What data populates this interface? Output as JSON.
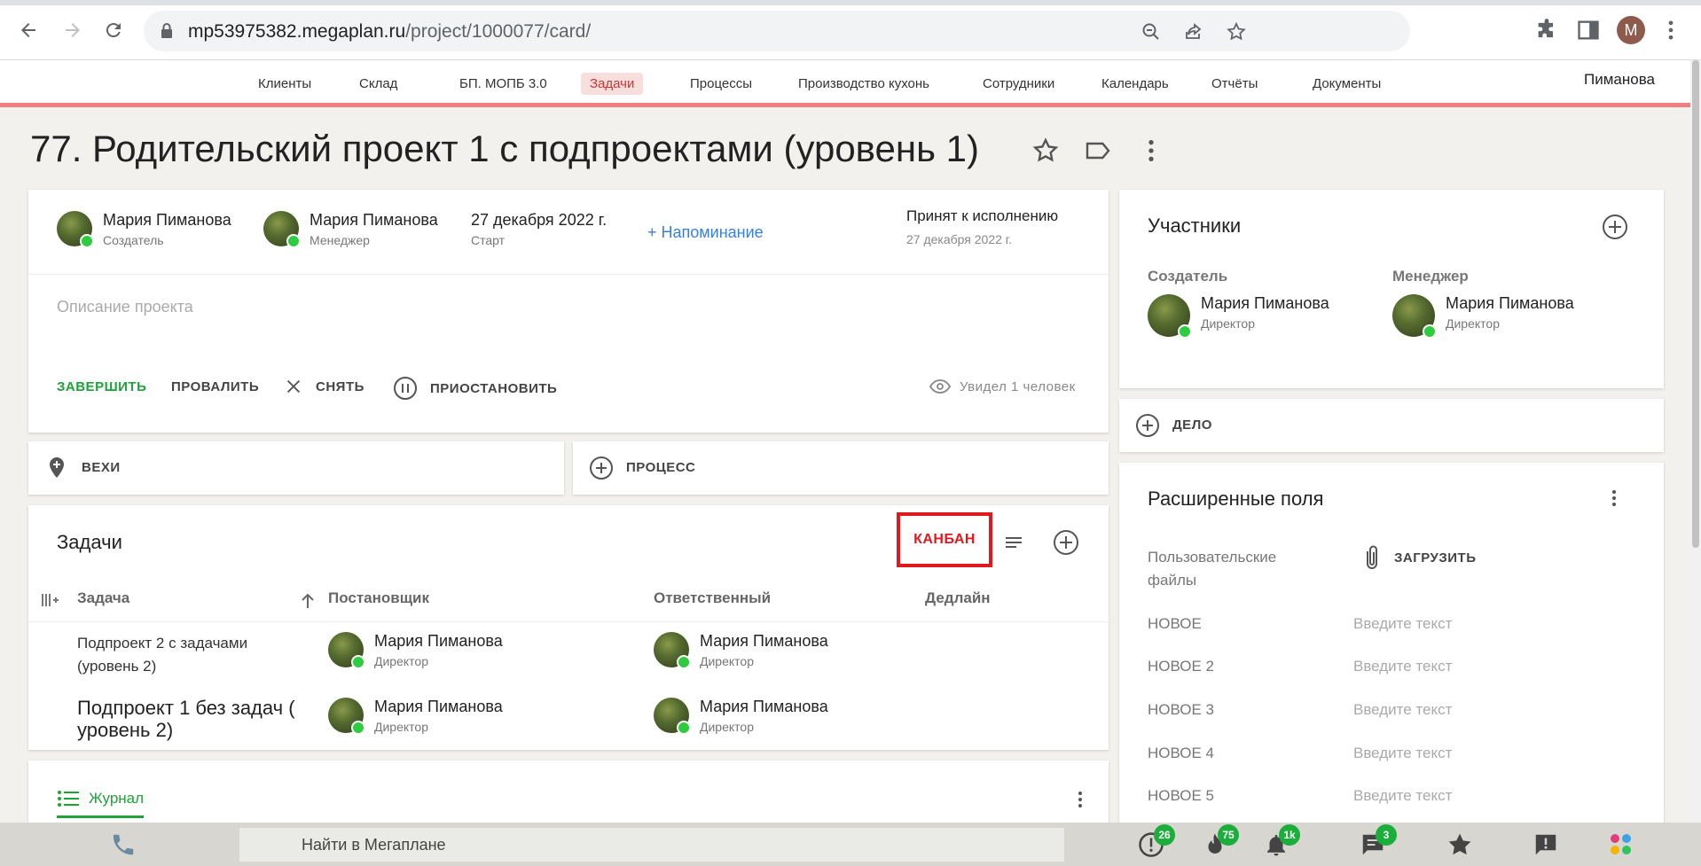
{
  "browser": {
    "url_host": "mp53975382.megaplan.ru",
    "url_path": "/project/1000077/card/",
    "profile_initial": "M"
  },
  "nav": {
    "items": [
      "Клиенты",
      "Склад",
      "БП. МОПБ 3.0",
      "Задачи",
      "Процессы",
      "Производство кухонь",
      "Сотрудники",
      "Календарь",
      "Отчёты",
      "Документы"
    ],
    "active": "Задачи",
    "user": "Пиманова"
  },
  "project": {
    "title": "77. Родительский проект 1 с подпроектами (уровень 1)",
    "creator": {
      "name": "Мария Пиманова",
      "role": "Создатель"
    },
    "manager": {
      "name": "Мария Пиманова",
      "role": "Менеджер"
    },
    "start": {
      "date": "27 декабря 2022 г.",
      "label": "Старт"
    },
    "reminder_label": "+ Напоминание",
    "status": {
      "label": "Принят к исполнению",
      "date": "27 декабря 2022 г."
    },
    "description_placeholder": "Описание проекта",
    "actions": {
      "complete": "ЗАВЕРШИТЬ",
      "fail": "ПРОВАЛИТЬ",
      "remove": "СНЯТЬ",
      "pause": "ПРИОСТАНОВИТЬ"
    },
    "seen": "Увидел 1 человек"
  },
  "milestones_label": "ВЕХИ",
  "process_label": "ПРОЦЕСС",
  "tasks": {
    "title": "Задачи",
    "kanban_label": "КАНБАН",
    "columns": [
      "Задача",
      "Постановщик",
      "Ответственный",
      "Дедлайн"
    ],
    "rows": [
      {
        "task": "Подпроект 2 с задачами (уровень 2)",
        "setter": "Мария Пиманова",
        "setter_role": "Директор",
        "resp": "Мария Пиманова",
        "resp_role": "Директор",
        "deadline": ""
      },
      {
        "task": "Подпроект 1 без задач ( уровень 2)",
        "setter": "Мария Пиманова",
        "setter_role": "Директор",
        "resp": "Мария Пиманова",
        "resp_role": "Директор",
        "deadline": ""
      }
    ]
  },
  "journal_label": "Журнал",
  "participants": {
    "title": "Участники",
    "creator_label": "Создатель",
    "manager_label": "Менеджер",
    "creator": {
      "name": "Мария Пиманова",
      "role": "Директор"
    },
    "manager": {
      "name": "Мария Пиманова",
      "role": "Директор"
    }
  },
  "deal_label": "ДЕЛО",
  "extended": {
    "title": "Расширенные поля",
    "files_label": "Пользовательские файлы",
    "upload_label": "ЗАГРУЗИТЬ",
    "fields": [
      {
        "label": "НОВОЕ",
        "placeholder": "Введите текст"
      },
      {
        "label": "НОВОЕ 2",
        "placeholder": "Введите текст"
      },
      {
        "label": "НОВОЕ 3",
        "placeholder": "Введите текст"
      },
      {
        "label": "НОВОЕ 4",
        "placeholder": "Введите текст"
      },
      {
        "label": "НОВОЕ 5",
        "placeholder": "Введите текст"
      }
    ]
  },
  "bottom": {
    "search_placeholder": "Найти в Мегаплане",
    "badges": {
      "alerts": "26",
      "hot": "75",
      "notifications": "1k",
      "messages": "3"
    }
  },
  "colors": {
    "accent_green": "#1fa23a",
    "accent_red": "#e0191f",
    "link_blue": "#3b7fd8",
    "nav_line": "#f07e7e"
  }
}
